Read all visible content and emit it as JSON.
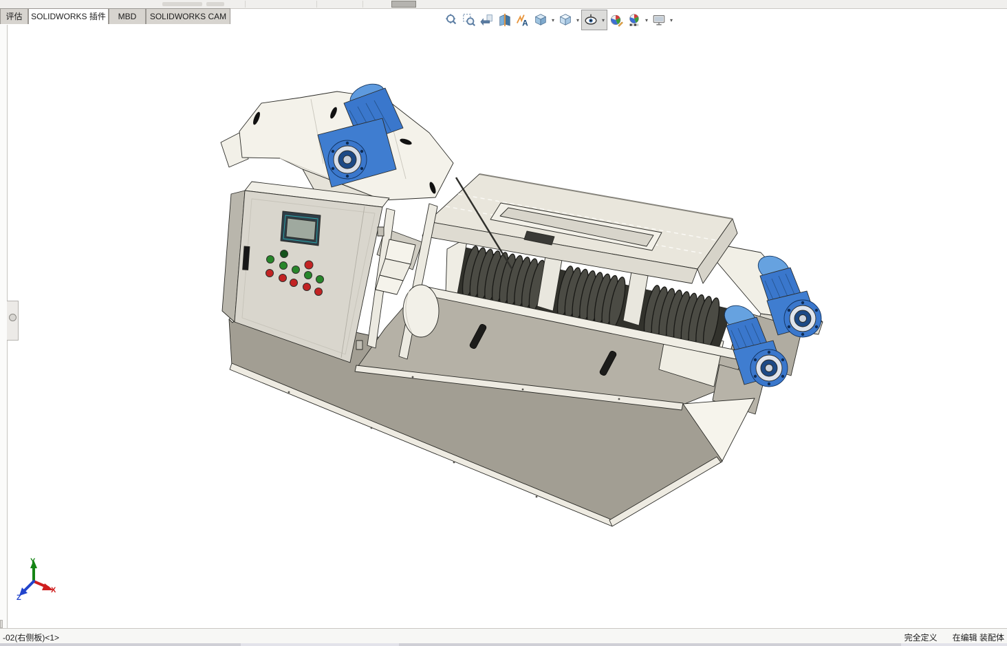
{
  "command_bar": {
    "tabs": [
      {
        "label": "评估",
        "active": false
      },
      {
        "label": "SOLIDWORKS 插件",
        "active": true
      },
      {
        "label": "MBD",
        "active": false
      },
      {
        "label": "SOLIDWORKS CAM",
        "active": false
      }
    ]
  },
  "heads_up_toolbar": {
    "buttons": [
      {
        "icon": "zoom-to-fit-icon"
      },
      {
        "icon": "zoom-to-area-icon"
      },
      {
        "icon": "previous-view-icon"
      },
      {
        "icon": "section-view-icon"
      },
      {
        "icon": "annotation-views-icon"
      },
      {
        "icon": "view-orientation-icon",
        "dropdown": true
      },
      {
        "icon": "display-style-icon",
        "dropdown": true
      },
      {
        "icon": "hide-show-items-icon",
        "dropdown": true,
        "pressed": true
      },
      {
        "icon": "edit-appearance-icon"
      },
      {
        "icon": "apply-scene-icon",
        "dropdown": true
      },
      {
        "icon": "view-settings-icon",
        "dropdown": true
      }
    ]
  },
  "viewport": {
    "triad": {
      "x_label": "X",
      "y_label": "Y",
      "z_label": "Z",
      "x_color": "#cf1f1f",
      "y_color": "#158515",
      "z_color": "#2244cc"
    },
    "model_colors": {
      "machine_white": "#f2f0e8",
      "frame_gray": "#a29e93",
      "motor_blue": "#3a77cc"
    }
  },
  "status_bar": {
    "selection": "-02(右侧板)<1>",
    "definition_status": "完全定义",
    "edit_status": "在编辑 装配体"
  }
}
